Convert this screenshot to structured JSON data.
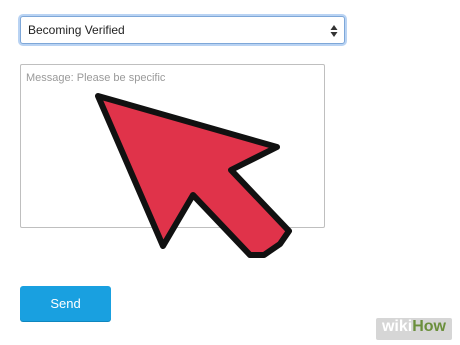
{
  "form": {
    "topic_select": {
      "selected_value": "Becoming Verified"
    },
    "message": {
      "placeholder": "Message: Please be specific",
      "value": ""
    },
    "send_button": {
      "label": "Send"
    }
  },
  "annotation": {
    "pointer": "red-arrow-icon",
    "color": "#e0334a"
  },
  "watermark": {
    "part1": "wiki",
    "part2": "How"
  },
  "colors": {
    "accent": "#19a0e0",
    "focus_ring": "#b9d3f3"
  }
}
